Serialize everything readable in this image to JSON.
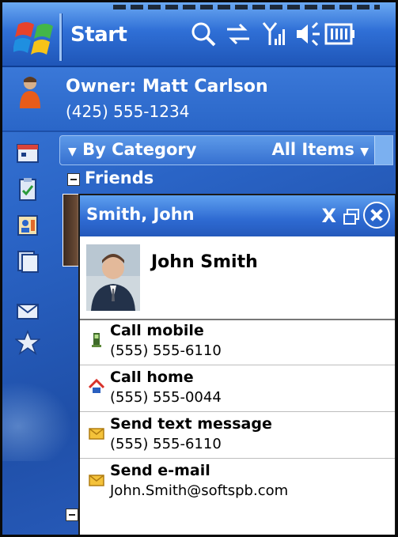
{
  "taskbar": {
    "start_label": "Start",
    "icons": [
      "windows-flag-icon",
      "search-icon",
      "connectivity-icon",
      "signal-icon",
      "volume-icon",
      "battery-icon"
    ]
  },
  "owner": {
    "name": "Owner: Matt Carlson",
    "phone": "(425) 555-1234"
  },
  "category_bar": {
    "left_label": "By Category",
    "right_label": "All Items"
  },
  "group": {
    "label": "Friends"
  },
  "card": {
    "title": "Smith, John",
    "close_glyph": "X",
    "contact_name": "John Smith",
    "actions": [
      {
        "icon": "mobile-phone-icon",
        "label": "Call mobile",
        "value": "(555) 555-6110"
      },
      {
        "icon": "home-icon",
        "label": "Call home",
        "value": "(555) 555-0044"
      },
      {
        "icon": "envelope-icon",
        "label": "Send text message",
        "value": "(555) 555-6110"
      },
      {
        "icon": "envelope-icon",
        "label": "Send e-mail",
        "value": "John.Smith@softspb.com"
      }
    ]
  },
  "colors": {
    "title_bar": "#2f6fd6",
    "background": "#2a64c6",
    "card_header": "#2e6ad2",
    "card_body": "#ffffff"
  }
}
